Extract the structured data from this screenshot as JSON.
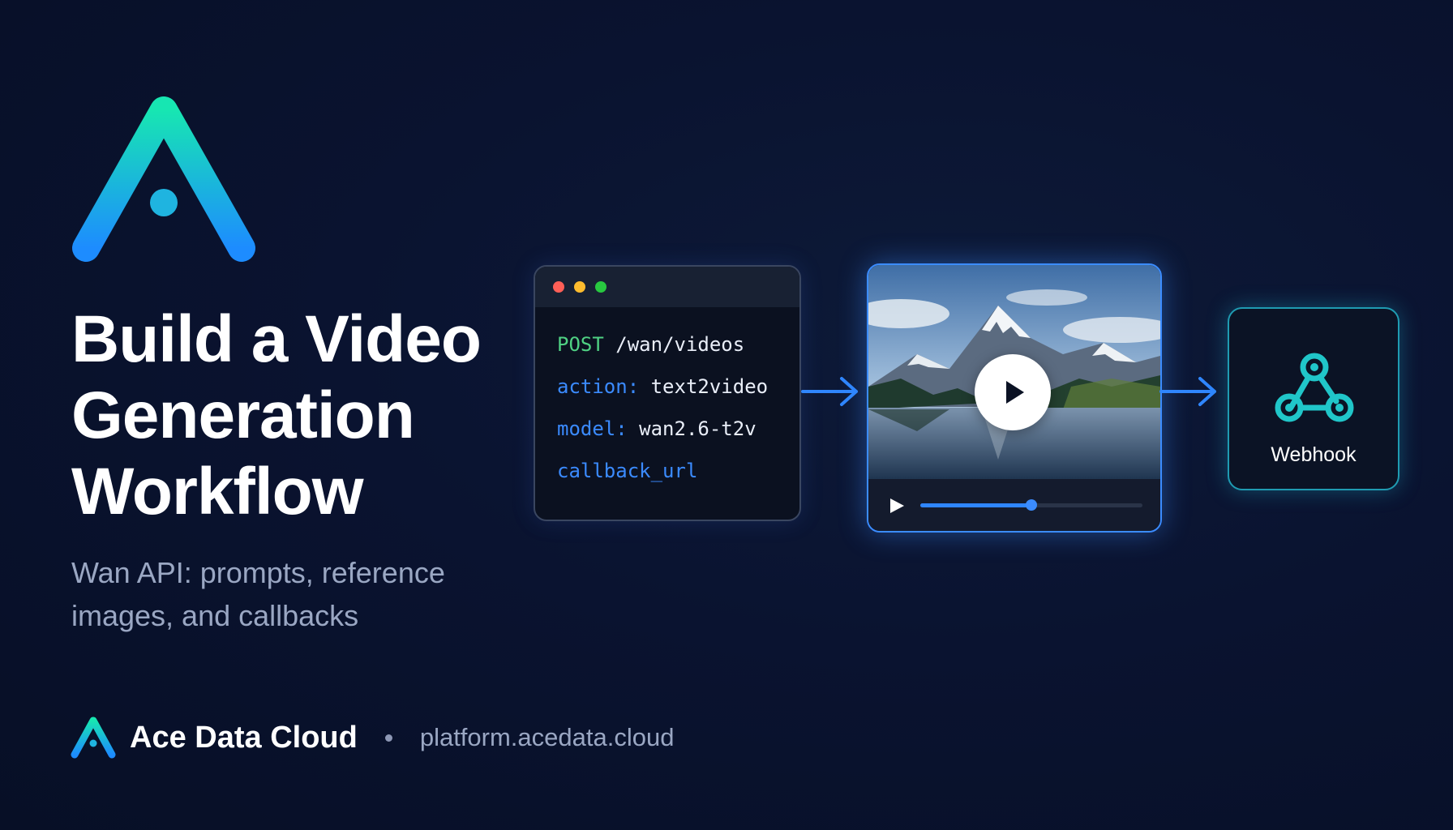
{
  "brand": {
    "logo_icon": "ace-data-cloud-logo",
    "name": "Ace Data Cloud",
    "url": "platform.acedata.cloud",
    "accent_gradient": [
      "#19e0b0",
      "#1e90ff"
    ]
  },
  "hero": {
    "title_lines": [
      "Build a Video",
      "Generation",
      "Workflow"
    ],
    "subtitle_lines": [
      "Wan API: prompts, reference",
      "images, and callbacks"
    ]
  },
  "code_window": {
    "lines": [
      {
        "key": "POST",
        "value": "/wan/videos",
        "key_color": "#4fd183"
      },
      {
        "key": "action:",
        "value": "text2video",
        "key_color": "#3b8bff"
      },
      {
        "key": "model:",
        "value": "wan2.6-t2v",
        "key_color": "#3b8bff"
      },
      {
        "key": "callback_url",
        "value": "",
        "key_color": "#3b8bff"
      }
    ],
    "window_dots": [
      "#ff5f57",
      "#febc2e",
      "#28c840"
    ]
  },
  "video_player": {
    "thumbnail": "mountain-lake-landscape",
    "progress": 0.5,
    "accent": "#3b8cff"
  },
  "webhook": {
    "icon": "webhook-icon",
    "label": "Webhook",
    "accent": "#20c6c9"
  }
}
